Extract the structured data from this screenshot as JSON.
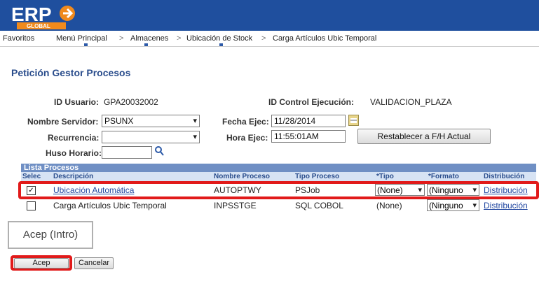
{
  "header": {
    "logo_text": "ERP",
    "logo_sub": "GLOBAL"
  },
  "nav": {
    "favoritos": "Favoritos",
    "menu_principal": "Menú Principal",
    "sep": ">",
    "almacenes": "Almacenes",
    "ubicacion_stock": "Ubicación de Stock",
    "carga": "Carga Artículos Ubic Temporal"
  },
  "page": {
    "title": "Petición Gestor Procesos"
  },
  "form": {
    "id_usuario_label": "ID Usuario:",
    "id_usuario_value": "GPA20032002",
    "id_control_label": "ID Control Ejecución:",
    "id_control_value": "VALIDACION_PLAZA",
    "servidor_label": "Nombre Servidor:",
    "servidor_value": "PSUNX",
    "recurrencia_label": "Recurrencia:",
    "recurrencia_value": "",
    "huso_label": "Huso Horario:",
    "huso_value": "",
    "fecha_label": "Fecha Ejec:",
    "fecha_value": "11/28/2014",
    "hora_label": "Hora Ejec:",
    "hora_value": "11:55:01AM",
    "reset_button": "Restablecer a F/H Actual"
  },
  "grid": {
    "title": "Lista Procesos",
    "columns": {
      "selec": "Selec",
      "descripcion": "Descripción",
      "nombre": "Nombre Proceso",
      "tipo_proceso": "Tipo Proceso",
      "tipo": "*Tipo",
      "formato": "*Formato",
      "distribucion": "Distribución"
    },
    "rows": [
      {
        "checked": "✓",
        "descripcion": "Ubicación Automática",
        "nombre": "AUTOPTWY",
        "tipo_proceso": "PSJob",
        "tipo": "(None)",
        "formato": "(Ninguno",
        "distribucion": "Distribución"
      },
      {
        "checked": "",
        "descripcion": "Carga Artículos Ubic Temporal",
        "nombre": "INPSSTGE",
        "tipo_proceso": "SQL COBOL",
        "tipo": "(None)",
        "formato": "(Ninguno",
        "distribucion": "Distribución"
      }
    ]
  },
  "tooltip": "Acep (Intro)",
  "buttons": {
    "acep": "Acep",
    "cancelar": "Cancelar"
  },
  "icons": {
    "calendar": "calendar-icon",
    "search": "search-icon",
    "dropdown": "chevron-down-icon"
  },
  "colors": {
    "header_bg": "#1f4f9e",
    "title": "#2a4d8c",
    "highlight": "#e11a1a",
    "link": "#2046a0"
  }
}
